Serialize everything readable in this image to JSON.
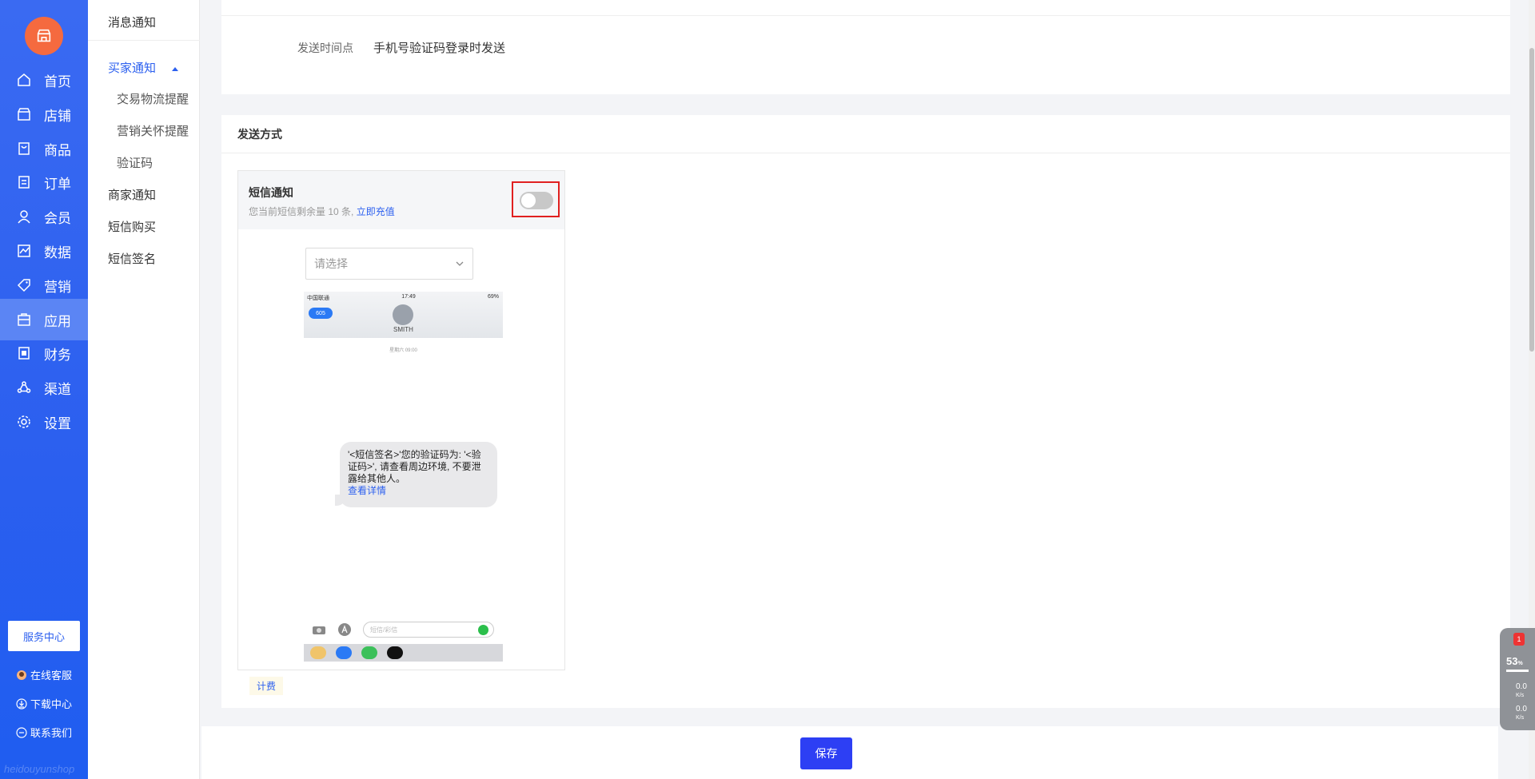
{
  "nav": {
    "items": [
      {
        "label": "首页",
        "icon": "home-icon"
      },
      {
        "label": "店铺",
        "icon": "store-icon"
      },
      {
        "label": "商品",
        "icon": "product-icon"
      },
      {
        "label": "订单",
        "icon": "order-icon"
      },
      {
        "label": "会员",
        "icon": "user-icon"
      },
      {
        "label": "数据",
        "icon": "chart-icon"
      },
      {
        "label": "营销",
        "icon": "tag-icon"
      },
      {
        "label": "应用",
        "icon": "app-icon"
      },
      {
        "label": "财务",
        "icon": "finance-icon"
      },
      {
        "label": "渠道",
        "icon": "channel-icon"
      },
      {
        "label": "设置",
        "icon": "gear-icon"
      }
    ],
    "active": "应用",
    "service_center": "服务中心",
    "links": [
      "在线客服",
      "下载中心",
      "联系我们"
    ],
    "watermark": "heidouyunshop",
    "accent": "#2b5fef"
  },
  "subnav": {
    "title": "消息通知",
    "buyer": "买家通知",
    "buyer_children": [
      "交易物流提醒",
      "营销关怀提醒",
      "验证码"
    ],
    "others": [
      "商家通知",
      "短信购买",
      "短信签名"
    ]
  },
  "trigger": {
    "label": "发送时间点",
    "value": "手机号验证码登录时发送"
  },
  "method": {
    "title": "发送方式",
    "sms": {
      "title": "短信通知",
      "remaining_prefix": "您当前短信剩余量 10 条,",
      "recharge": "立即充值",
      "enabled": false,
      "select_placeholder": "请选择",
      "preview": {
        "carrier": "中国联通",
        "time": "17:49",
        "battery": "69%",
        "back_badge": "605",
        "contact": "SMITH",
        "timestamp": "星期六 09:00",
        "message": "'<短信签名>'您的验证码为: '<验证码>', 请查看周边环境, 不要泄露给其他人。",
        "message_link": "查看详情",
        "input_placeholder": "短信/彩信"
      },
      "fee_label": "计费"
    }
  },
  "footer": {
    "save": "保存",
    "save_color": "#2d3ff4"
  },
  "widget": {
    "badge": "1",
    "percent": "53",
    "percent_unit": "%",
    "up": "0.0",
    "down": "0.0",
    "unit": "K/s"
  }
}
